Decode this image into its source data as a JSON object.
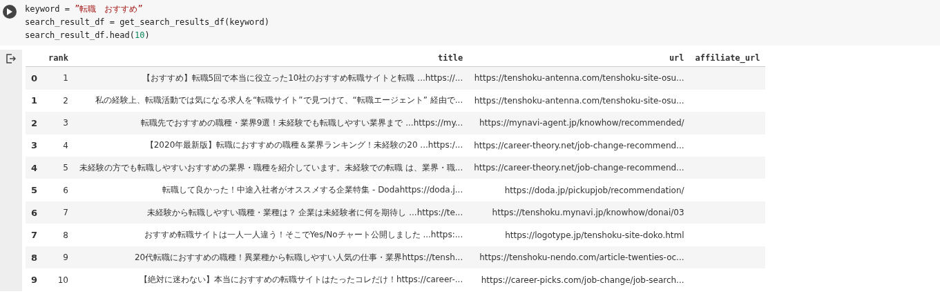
{
  "code_cell": {
    "lines": [
      [
        {
          "kind": "plain",
          "text": "keyword = "
        },
        {
          "kind": "string",
          "text": "”転職　おすすめ”"
        }
      ],
      [
        {
          "kind": "plain",
          "text": "search_result_df = get_search_results_df(keyword)"
        }
      ],
      [
        {
          "kind": "plain",
          "text": "search_result_df.head("
        },
        {
          "kind": "number",
          "text": "10"
        },
        {
          "kind": "plain",
          "text": ")"
        }
      ]
    ]
  },
  "output_table": {
    "columns": [
      "rank",
      "title",
      "url",
      "affiliate_url"
    ],
    "rows": [
      {
        "index": "0",
        "cells": [
          "1",
          "【おすすめ】転職5回で本当に役立った10社のおすすめ転職サイトと転職 ...https://...",
          "https://tenshoku-antenna.com/tenshoku-site-osu...",
          ""
        ]
      },
      {
        "index": "1",
        "cells": [
          "2",
          "私の経験上、転職活動では気になる求人を“転職サイト”で見つけて、“転職エージェント” 経由で...",
          "https://tenshoku-antenna.com/tenshoku-site-osu...",
          ""
        ]
      },
      {
        "index": "2",
        "cells": [
          "3",
          "転職先でおすすめの職種・業界9選！未経験でも転職しやすい業界まで ...https://my...",
          "https://mynavi-agent.jp/knowhow/recommended/",
          ""
        ]
      },
      {
        "index": "3",
        "cells": [
          "4",
          "【2020年最新版】転職におすすめの職種＆業界ランキング！未経験の20 ...https:/...",
          "https://career-theory.net/job-change-recommend...",
          ""
        ]
      },
      {
        "index": "4",
        "cells": [
          "5",
          "未経験の方でも転職しやすいおすすめの業界・職種を紹介しています。未経験での転職 は、業界・職...",
          "https://career-theory.net/job-change-recommend...",
          ""
        ]
      },
      {
        "index": "5",
        "cells": [
          "6",
          "転職して良かった！中途入社者がオススメする企業特集 - Dodahttps://doda.j...",
          "https://doda.jp/pickupjob/recommendation/",
          ""
        ]
      },
      {
        "index": "6",
        "cells": [
          "7",
          "未経験から転職しやすい職種・業種は？ 企業は未経験者に何を期待し ...https://te...",
          "https://tenshoku.mynavi.jp/knowhow/donai/03",
          ""
        ]
      },
      {
        "index": "7",
        "cells": [
          "8",
          "おすすめ転職サイトは一人一人違う！そこでYes/Noチャート公開しました ...https:...",
          "https://logotype.jp/tenshoku-site-doko.html",
          ""
        ]
      },
      {
        "index": "8",
        "cells": [
          "9",
          "20代転職におすすめの職種！異業種から転職しやすい人気の仕事・業界https://tensh...",
          "https://tenshoku-nendo.com/article-twenties-oc...",
          ""
        ]
      },
      {
        "index": "9",
        "cells": [
          "10",
          "【絶対に迷わない】本当におすすめの転職サイトはたったコレだけ！https://career-...",
          "https://career-picks.com/job-change/job-search...",
          ""
        ]
      }
    ]
  }
}
